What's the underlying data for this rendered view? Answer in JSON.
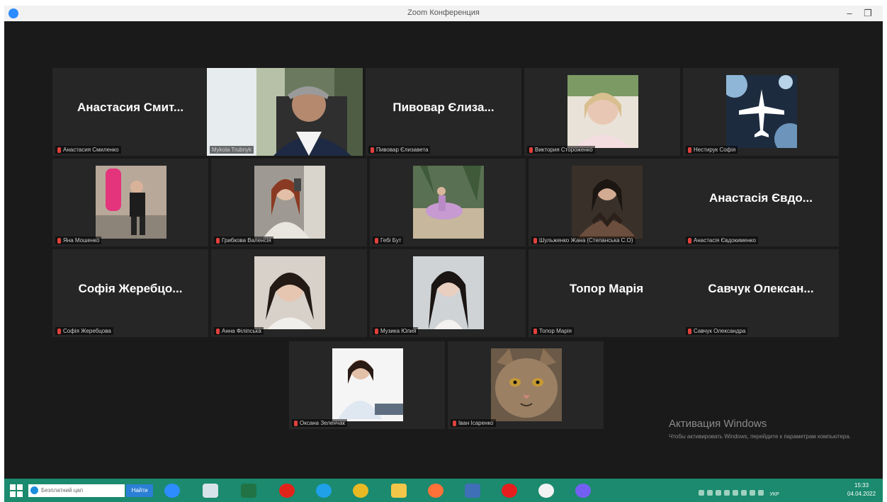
{
  "window": {
    "title": "Zoom Конференция",
    "min_glyph": "‒",
    "max_glyph": "❐",
    "close_glyph": "×"
  },
  "participants": {
    "anastasia_s": {
      "display_name": "Анастасия Смит...",
      "label": "Анастасия Смиленко"
    },
    "mykola": {
      "label": "Mykola Trubnyk"
    },
    "pyvovar": {
      "display_name": "Пивовар Єлиза...",
      "label": "Пивовар Єлизавета"
    },
    "viktoria": {
      "label": "Виктория Стороженко"
    },
    "nestyruk": {
      "label": "Нестирук Софія"
    },
    "yana": {
      "label": "Яна Мошенко"
    },
    "hrybkova": {
      "label": "Грибкова Валенсія"
    },
    "gebi": {
      "label": "Гебі Бут"
    },
    "shulzhenko": {
      "label": "Шульженко Жана (Степанська С.О)"
    },
    "anastasia_e": {
      "display_name": "Анастасія Євдо...",
      "label": "Анастасія Євдокименко"
    },
    "sofia": {
      "display_name": "Софія Жеребцо...",
      "label": "Софія Жеребцова"
    },
    "anna": {
      "label": "Анна Філіпська"
    },
    "muzyka": {
      "label": "Музика Юлия"
    },
    "topor": {
      "display_name": "Топор Марія",
      "label": "Топор Марія"
    },
    "savchuk": {
      "display_name": "Савчук Олексан...",
      "label": "Савчук Олександра"
    },
    "oksana": {
      "label": "Оксана Зеленчак"
    },
    "ivan": {
      "label": "Іван Ісаренко"
    }
  },
  "watermark": {
    "title": "Активация Windows",
    "subtitle": "Чтобы активировать Windows, перейдите к параметрам компьютера."
  },
  "taskbar": {
    "search_placeholder": "Безплатний цап",
    "search_button": "Найти",
    "lang": "УКР",
    "time": "15:33",
    "date": "04.04.2022"
  },
  "icons": {
    "app_icon": "zoom-logo-icon",
    "start": "windows-start-icon",
    "taskbar_apps": [
      "zoom-icon",
      "file-icon",
      "excel-icon",
      "opera-icon",
      "ie-icon",
      "chrome-icon",
      "explorer-icon",
      "firefox-icon",
      "media-icon",
      "yandex-icon",
      "yandex-browser-icon",
      "viber-icon"
    ]
  },
  "colors": {
    "active_speaker": "#c9e35a",
    "muted_mic": "#e0413c",
    "taskbar": "#1b8a6e",
    "zoom_blue": "#2d8cff"
  }
}
